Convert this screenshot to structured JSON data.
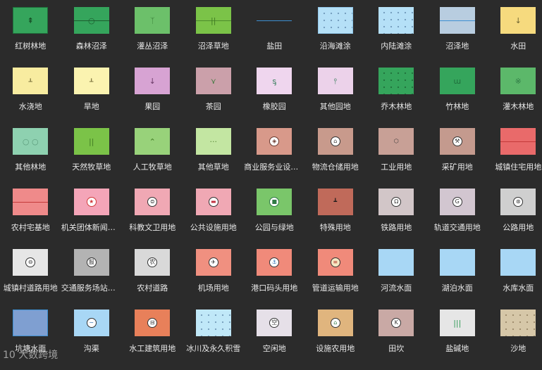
{
  "watermark": "10 大数跨境",
  "items": [
    {
      "label": "红树林地",
      "icon": "mangrove-icon",
      "bg": "#35a55c",
      "border": "#1f6e3c",
      "glyph": "⇞",
      "gc": "#12441f"
    },
    {
      "label": "森林沼泽",
      "icon": "forest-swamp-icon",
      "bg": "#35a55c",
      "line": "#1d5c2f",
      "glyph": "○",
      "gc": "#1d5c2f"
    },
    {
      "label": "灌丛沼泽",
      "icon": "shrub-swamp-icon",
      "bg": "#6cc06a",
      "glyph": "ᛉ",
      "gc": "#3a7e39"
    },
    {
      "label": "沼泽草地",
      "icon": "swamp-grassland-icon",
      "bg": "#7bc348",
      "line": "#4e8a2c",
      "glyph": "||",
      "gc": "#3f7a22"
    },
    {
      "label": "盐田",
      "icon": "salt-field-icon",
      "bg": "transparent",
      "line": "#3d8fd1"
    },
    {
      "label": "沿海滩涂",
      "icon": "coastal-tidal-flat-icon",
      "bg": "#b5e0f7",
      "border": "#8fc6e8",
      "dots": true
    },
    {
      "label": "内陆滩涂",
      "icon": "inland-tidal-flat-icon",
      "bg": "#b5e0f7",
      "dots": true
    },
    {
      "label": "沼泽地",
      "icon": "marshland-icon",
      "bg": "#b8cde0",
      "line": "#3d8fd1"
    },
    {
      "label": "水田",
      "icon": "paddy-field-icon",
      "bg": "#f6da7e",
      "glyph": "↓",
      "gc": "#6d6430"
    },
    {
      "label": "水浇地",
      "icon": "irrigated-land-icon",
      "bg": "#f8eca0",
      "glyph": "ᚆ",
      "gc": "#6d6430"
    },
    {
      "label": "旱地",
      "icon": "dry-land-icon",
      "bg": "#fbf3b0",
      "glyph": "ᚆ",
      "gc": "#6d6430"
    },
    {
      "label": "果园",
      "icon": "orchard-icon",
      "bg": "#d7a3d3",
      "glyph": "↓",
      "gc": "#6a3a66"
    },
    {
      "label": "茶园",
      "icon": "tea-garden-icon",
      "bg": "#cba0aa",
      "glyph": "⋎",
      "gc": "#3e7a3e"
    },
    {
      "label": "橡胶园",
      "icon": "rubber-plantation-icon",
      "bg": "#efd6ee",
      "glyph": "ᶊ",
      "gc": "#2f7a55"
    },
    {
      "label": "其他园地",
      "icon": "other-garden-icon",
      "bg": "#ecd2ea",
      "glyph": "⫯",
      "gc": "#2f7a55"
    },
    {
      "label": "乔木林地",
      "icon": "arbor-forest-icon",
      "bg": "#35a55c",
      "dots": true,
      "dc": "dark"
    },
    {
      "label": "竹林地",
      "icon": "bamboo-forest-icon",
      "bg": "#35a55c",
      "glyph": "ɯ",
      "gc": "#1f6e3c"
    },
    {
      "label": "灌木林地",
      "icon": "shrub-forest-icon",
      "bg": "#5cb86a",
      "glyph": "※",
      "gc": "#2f7a45"
    },
    {
      "label": "其他林地",
      "icon": "other-forest-icon",
      "bg": "#8ed1b0",
      "glyph": "○  ○",
      "gc": "#5a9a7a"
    },
    {
      "label": "天然牧草地",
      "icon": "natural-pasture-icon",
      "bg": "#7bc348",
      "glyph": "||",
      "gc": "#3f7a22"
    },
    {
      "label": "人工牧草地",
      "icon": "artificial-pasture-icon",
      "bg": "#98d27a",
      "glyph": "⌃",
      "gc": "#3f7a22"
    },
    {
      "label": "其他草地",
      "icon": "other-grassland-icon",
      "bg": "#c3e6a2",
      "glyph": "···",
      "gc": "#5a8a3a"
    },
    {
      "label": "商业服务业设施用地",
      "icon": "commercial-land-icon",
      "bg": "#d8998a",
      "circ": "◈",
      "cbg": "#ffffff",
      "cc": "#6a3a30",
      "cb": "#6a3a30"
    },
    {
      "label": "物流仓储用地",
      "icon": "logistics-storage-icon",
      "bg": "#c89a8c",
      "circ": "⌂",
      "cbg": "#ffffff",
      "cc": "#333333",
      "cb": "#333333"
    },
    {
      "label": "工业用地",
      "icon": "industrial-land-icon",
      "bg": "#c8a096",
      "circ": "⬡",
      "cbg": "transparent",
      "cc": "#333333",
      "cb": "transparent"
    },
    {
      "label": "采矿用地",
      "icon": "mining-land-icon",
      "bg": "#c49a8e",
      "circ": "⚒",
      "cbg": "#ffffff",
      "cc": "#333333",
      "cb": "#333333"
    },
    {
      "label": "城镇住宅用地",
      "icon": "urban-residential-icon",
      "bg": "#e96a6a",
      "line": "#c43a3a"
    },
    {
      "label": "农村宅基地",
      "icon": "rural-homestead-icon",
      "bg": "#ef8a8a",
      "line": "#c43a3a"
    },
    {
      "label": "机关团体新闻出版用地",
      "icon": "government-institution-icon",
      "bg": "#f4a5b8",
      "circ": "★",
      "cbg": "#ffffff",
      "cc": "#d03a3a",
      "cb": "#d03a3a"
    },
    {
      "label": "科教文卫用地",
      "icon": "science-education-icon",
      "bg": "#f0a8b4",
      "circ": "⊜",
      "cbg": "#ffffff",
      "cc": "#333333",
      "cb": "#333333"
    },
    {
      "label": "公共设施用地",
      "icon": "public-facility-icon",
      "bg": "#f0a8b4",
      "circ": "▬",
      "cbg": "#ffffff",
      "cc": "#c03040",
      "cb": "#333333"
    },
    {
      "label": "公园与绿地",
      "icon": "park-green-space-icon",
      "bg": "#7ac66a",
      "circ": "■",
      "cbg": "#ffffff",
      "cc": "#2f7a45",
      "cb": "#2f7a45"
    },
    {
      "label": "特殊用地",
      "icon": "special-land-icon",
      "bg": "#c06a5a",
      "circ": "┻",
      "cbg": "transparent",
      "cc": "#1a1a1a",
      "cb": "transparent"
    },
    {
      "label": "铁路用地",
      "icon": "railway-land-icon",
      "bg": "#d2c6c8",
      "circ": "Ω",
      "cbg": "#ffffff",
      "cc": "#333333",
      "cb": "#333333"
    },
    {
      "label": "轨道交通用地",
      "icon": "rail-transit-icon",
      "bg": "#d2c6d0",
      "circ": "G",
      "cbg": "#ffffff",
      "cc": "#333333",
      "cb": "#333333"
    },
    {
      "label": "公路用地",
      "icon": "highway-land-icon",
      "bg": "#cfcfcf",
      "circ": "⊛",
      "cbg": "#ffffff",
      "cc": "#333333",
      "cb": "#333333"
    },
    {
      "label": "城镇村道路用地",
      "icon": "town-village-road-icon",
      "bg": "#e6e6e6",
      "circ": "⊖",
      "cbg": "#ffffff",
      "cc": "#333333",
      "cb": "#333333"
    },
    {
      "label": "交通服务场站用地",
      "icon": "transport-station-icon",
      "bg": "#b3b3b3",
      "circ": "服",
      "cbg": "#ffffff",
      "cc": "#333333",
      "cb": "#333333"
    },
    {
      "label": "农村道路",
      "icon": "rural-road-icon",
      "bg": "#d9d9d9",
      "circ": "农",
      "cbg": "#ffffff",
      "cc": "#333333",
      "cb": "#333333"
    },
    {
      "label": "机场用地",
      "icon": "airport-land-icon",
      "bg": "#f09080",
      "circ": "✈",
      "cbg": "#ffffff",
      "cc": "#333333",
      "cb": "#333333"
    },
    {
      "label": "港口码头用地",
      "icon": "port-wharf-icon",
      "bg": "#f08a7a",
      "circ": "⚓",
      "cbg": "#ffffff",
      "cc": "#2a6fb0",
      "cb": "#333333"
    },
    {
      "label": "管道运输用地",
      "icon": "pipeline-transport-icon",
      "bg": "#f08a7a",
      "circ": "≡",
      "cbg": "#f6e9c4",
      "cc": "#b84a3a",
      "cb": "#333333"
    },
    {
      "label": "河流水面",
      "icon": "river-surface-icon",
      "bg": "#a8d7f5"
    },
    {
      "label": "湖泊水面",
      "icon": "lake-surface-icon",
      "bg": "#a8d7f5"
    },
    {
      "label": "水库水面",
      "icon": "reservoir-surface-icon",
      "bg": "#a8d7f5"
    },
    {
      "label": "坑塘水面",
      "icon": "pond-surface-icon",
      "bg": "#7f9fd1",
      "border": "#3d8fd1"
    },
    {
      "label": "沟渠",
      "icon": "ditch-icon",
      "bg": "#a8d7f5",
      "circ": "∼",
      "cbg": "#ffffff",
      "cc": "#2a6fb0",
      "cb": "#333333"
    },
    {
      "label": "水工建筑用地",
      "icon": "hydraulic-building-icon",
      "bg": "#e8805a",
      "circ": "⊟",
      "cbg": "#ffffff",
      "cc": "#333333",
      "cb": "#333333"
    },
    {
      "label": "冰川及永久积雪",
      "icon": "glacier-snow-icon",
      "bg": "#c0e8f8",
      "dots": true
    },
    {
      "label": "空闲地",
      "icon": "vacant-land-icon",
      "bg": "#e6e0e8",
      "circ": "空",
      "cbg": "#ffffff",
      "cc": "#333333",
      "cb": "#333333"
    },
    {
      "label": "设施农用地",
      "icon": "facility-agriculture-icon",
      "bg": "#e0b57e",
      "circ": "⌂",
      "cbg": "#ffffff",
      "cc": "#2f7a45",
      "cb": "#333333"
    },
    {
      "label": "田坎",
      "icon": "field-ridge-icon",
      "bg": "#c9a9a5",
      "circ": "K",
      "cbg": "#ffffff",
      "cc": "#333333",
      "cb": "#333333"
    },
    {
      "label": "盐碱地",
      "icon": "saline-alkali-land-icon",
      "bg": "#e6e6e6",
      "glyph": "|||",
      "gc": "#2f9a55"
    },
    {
      "label": "沙地",
      "icon": "sandy-land-icon",
      "bg": "#d6c7a8",
      "dots": true,
      "dc": "sand"
    }
  ]
}
